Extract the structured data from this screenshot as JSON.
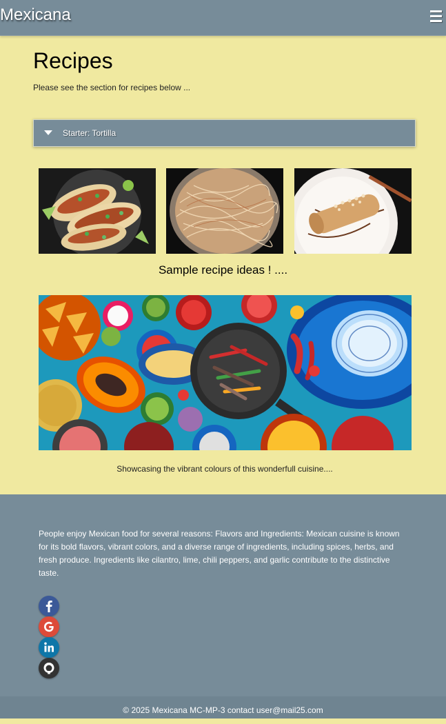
{
  "header": {
    "brand": "Mexicana",
    "menu_icon": "hamburger-menu-icon"
  },
  "main": {
    "title": "Recipes",
    "intro": "Please see the section for recipes below ...",
    "accordion": {
      "label": "Starter: Tortilla",
      "icon": "caret-down-icon"
    },
    "thumbnails": [
      "tacos",
      "noodles",
      "rolled crepe dessert"
    ],
    "sample_caption": "Sample recipe ideas ! ....",
    "banner_caption": "Showcasing the vibrant colours of this wonderfull cuisine...."
  },
  "footer": {
    "text": "People enjoy Mexican food for several reasons: Flavors and Ingredients: Mexican cuisine is known for its bold flavors, vibrant colors, and a diverse range of ingredients, including spices, herbs, and fresh produce. Ingredients like cilantro, lime, chili peppers, and garlic contribute to the distinctive taste.",
    "social": [
      {
        "icon": "facebook-icon",
        "color": "#3b5998"
      },
      {
        "icon": "google-icon",
        "color": "#dd4b39"
      },
      {
        "icon": "linkedin-icon",
        "color": "#0e76a8"
      },
      {
        "icon": "github-icon",
        "color": "#333333"
      }
    ],
    "copyright": "© 2025 Mexicana MC-MP-3 contact user@mail25.com"
  },
  "colors": {
    "page_bg": "#f0e9a0",
    "bar_bg": "#778c99",
    "copyright_bg": "#6f8491"
  }
}
